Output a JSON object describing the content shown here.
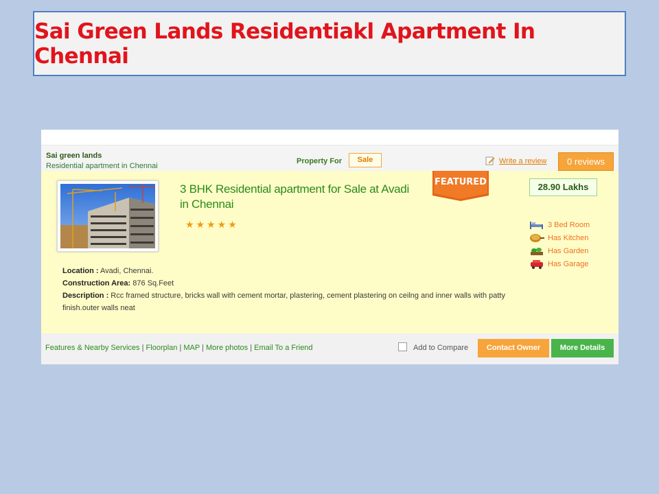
{
  "slide": {
    "title": "Sai Green Lands Residentiakl Apartment In Chennai"
  },
  "header": {
    "owner_name": "Sai green lands",
    "owner_subtitle": "Residential apartment in Chennai",
    "property_for_label": "Property For",
    "property_for_value": "Sale",
    "write_review": "Write a review",
    "reviews_count": "0",
    "reviews_label": "reviews"
  },
  "listing": {
    "title": "3 BHK Residential apartment for Sale at Avadi in Chennai",
    "rating_stars": 5,
    "stars_text": "★★★★★",
    "featured_label": "FEATURED",
    "price": "28.90 Lakhs",
    "amenities": [
      {
        "icon": "bed-icon",
        "label": "3 Bed Room"
      },
      {
        "icon": "kitchen-icon",
        "label": "Has Kitchen"
      },
      {
        "icon": "garden-icon",
        "label": "Has Garden"
      },
      {
        "icon": "garage-icon",
        "label": "Has Garage"
      }
    ],
    "location_label": "Location :",
    "location_value": "Avadi, Chennai.",
    "area_label": "Construction Area:",
    "area_value": "876 Sq.Feet",
    "description_label": "Description :",
    "description_value": "Rcc framed structure, bricks wall with cement mortar, plastering, cement plastering on ceilng and inner walls with patty finish.outer walls neat"
  },
  "footer": {
    "links": [
      "Features & Nearby Services",
      "Floorplan",
      "MAP",
      "More photos",
      "Email To a Friend"
    ],
    "separator": "|",
    "compare_label": "Add to Compare",
    "compare_checked": false,
    "contact_button": "Contact Owner",
    "details_button": "More Details"
  },
  "colors": {
    "background": "#b9cbe4",
    "title_red": "#e1141c",
    "accent_orange": "#f7a43a",
    "accent_green": "#49b44a",
    "listing_bg": "#fffdc7"
  }
}
